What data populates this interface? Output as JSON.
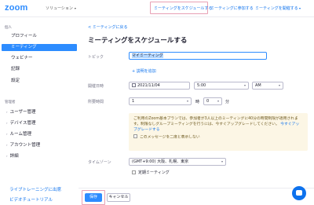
{
  "header": {
    "logo": "zoom",
    "solutions": "ソリューション",
    "nav": [
      "ミーティングをスケジュールする",
      "ミーティングに参加する",
      "ミーティングを開催する"
    ]
  },
  "sidebar": {
    "personal_label": "個人",
    "personal_items": [
      "プロフィール",
      "ミーティング",
      "ウェビナー",
      "記録",
      "設定"
    ],
    "admin_label": "管理者",
    "admin_items": [
      "ユーザー管理",
      "デバイス管理",
      "ルーム管理",
      "アカウント管理",
      "詳細"
    ],
    "links": [
      "ライブトレーニングに出席",
      "ビデオチュートリアル"
    ]
  },
  "main": {
    "back": "< ミーティングに戻る",
    "title": "ミーティングをスケジュールする",
    "topic_label": "トピック",
    "topic_value": "マイミーティング",
    "add_description": "+ 説明を追加",
    "when_label": "開催日時",
    "date_value": "2021/11/04",
    "time_value": "5:00",
    "ampm_value": "AM",
    "duration_label": "所要時間",
    "hours_value": "1",
    "hours_unit": "時",
    "minutes_value": "0",
    "minutes_unit": "分",
    "notice_text": "ご利用のZoom基本プランでは、参加者が3人以上のミーティングに40分の時間制限が適用されます。制限なしグループミーティングを行うには、今すぐアップグレードしてください。",
    "notice_link": "今すぐアップグレードする",
    "notice_dismiss": "このメッセージを二度と表示しない",
    "timezone_label": "タイムゾーン",
    "timezone_value": "(GMT+9:00) 大阪、札幌、東京",
    "recurring_label": "定期ミーティング",
    "save": "保存",
    "cancel": "キャンセル"
  }
}
